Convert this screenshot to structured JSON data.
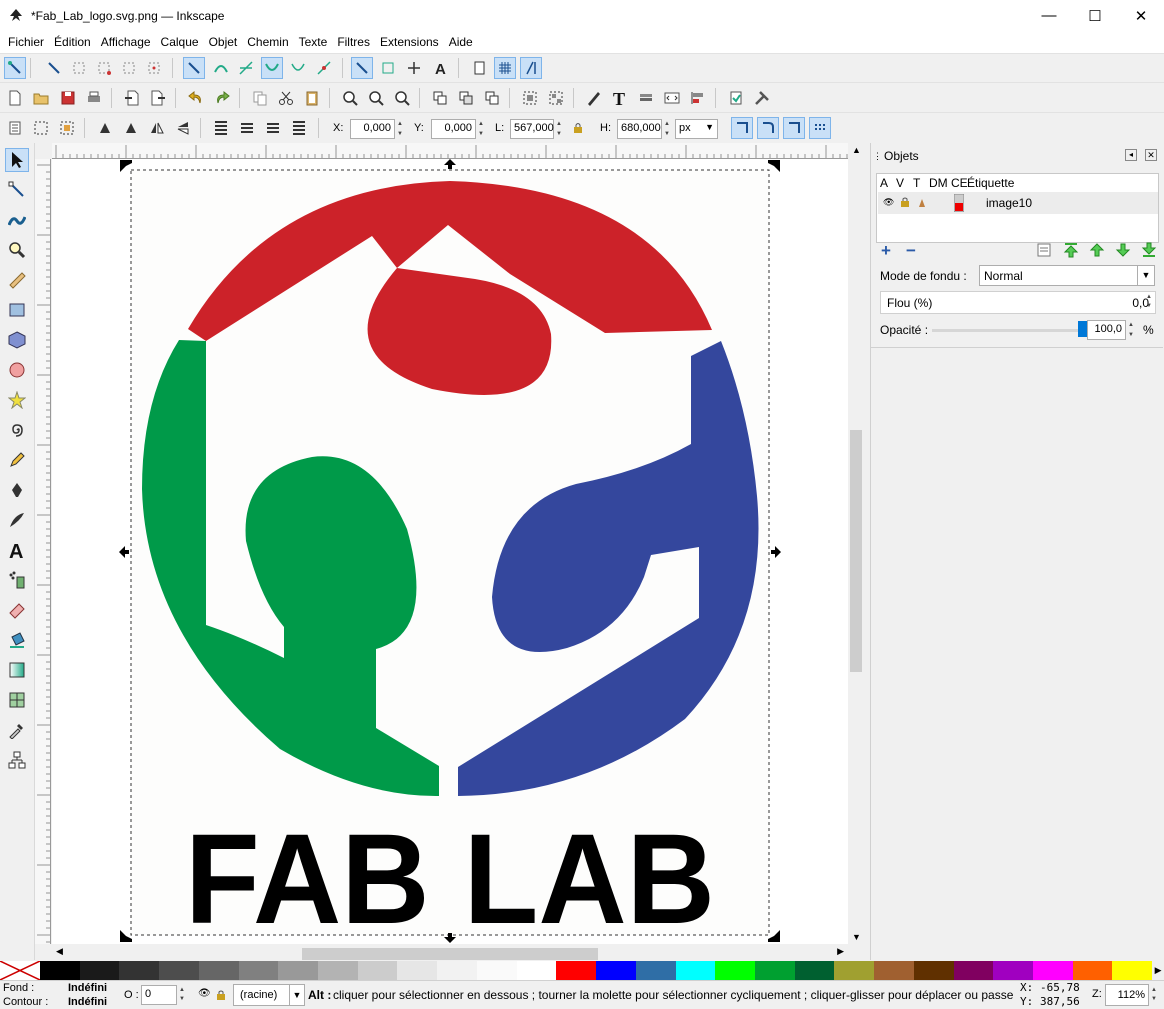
{
  "window": {
    "title": "*Fab_Lab_logo.svg.png — Inkscape",
    "minimize": "—",
    "maximize": "☐",
    "close": "✕"
  },
  "menu": [
    "Fichier",
    "Édition",
    "Affichage",
    "Calque",
    "Objet",
    "Chemin",
    "Texte",
    "Filtres",
    "Extensions",
    "Aide"
  ],
  "toolcontrols": {
    "x_label": "X:",
    "x_value": "0,000",
    "y_label": "Y:",
    "y_value": "0,000",
    "w_label": "L:",
    "w_value": "567,000",
    "h_label": "H:",
    "h_value": "680,000",
    "unit": "px"
  },
  "logo": {
    "text": "FAB LAB",
    "colors": {
      "red": "#cc2229",
      "green": "#009a49",
      "blue": "#34479d",
      "text": "#000000"
    }
  },
  "objects_panel": {
    "title": "Objets",
    "columns": [
      "A",
      "V",
      "T",
      "DM",
      "CE",
      "Étiquette"
    ],
    "rows": [
      {
        "label": "image10"
      }
    ],
    "blend_label": "Mode de fondu :",
    "blend_value": "Normal",
    "blur_label": "Flou (%)",
    "blur_value": "0,0",
    "opacity_label": "Opacité :",
    "opacity_value": "100,0",
    "opacity_unit": "%",
    "opacity_fraction": 1.0
  },
  "palette": [
    "#000000",
    "#1a1a1a",
    "#333333",
    "#4d4d4d",
    "#666666",
    "#808080",
    "#999999",
    "#b3b3b3",
    "#cccccc",
    "#e6e6e6",
    "#f2f2f2",
    "#fafafa",
    "#ffffff",
    "#ff0000",
    "#0000ff",
    "#2f6ea6",
    "#00ffff",
    "#00ff00",
    "#00a030",
    "#006030",
    "#a0a030",
    "#a06030",
    "#603000",
    "#800060",
    "#a000c0",
    "#ff00ff",
    "#ff6000",
    "#ffff00"
  ],
  "status": {
    "fill_label": "Fond :",
    "fill_value": "Indéfini",
    "stroke_label": "Contour :",
    "stroke_value": "Indéfini",
    "opacity_label": "O :",
    "opacity_value": "0",
    "layer": "(racine)",
    "message_bold": "Alt :",
    "message": "cliquer pour sélectionner en dessous ; tourner la molette pour sélectionner cycliquement ; cliquer-glisser pour déplacer ou passe...",
    "x_label": "X:",
    "x_value": "-65,78",
    "y_label": "Y:",
    "y_value": "387,56",
    "zoom_label": "Z:",
    "zoom_value": "112%"
  }
}
